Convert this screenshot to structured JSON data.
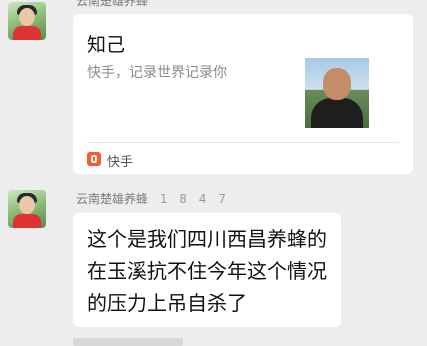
{
  "messages": [
    {
      "sender": "云南楚雄养蜂",
      "card": {
        "title": "知己",
        "description": "快手，记录世界记录你",
        "source_label": "快手",
        "source_icon": "kuaishou-logo-icon"
      }
    },
    {
      "sender": "云南楚雄养蜂",
      "sender_suffix": "1 8 4 7",
      "text": "这个是我们四川西昌养蜂的在玉溪抗不住今年这个情况的压力上吊自杀了"
    }
  ]
}
